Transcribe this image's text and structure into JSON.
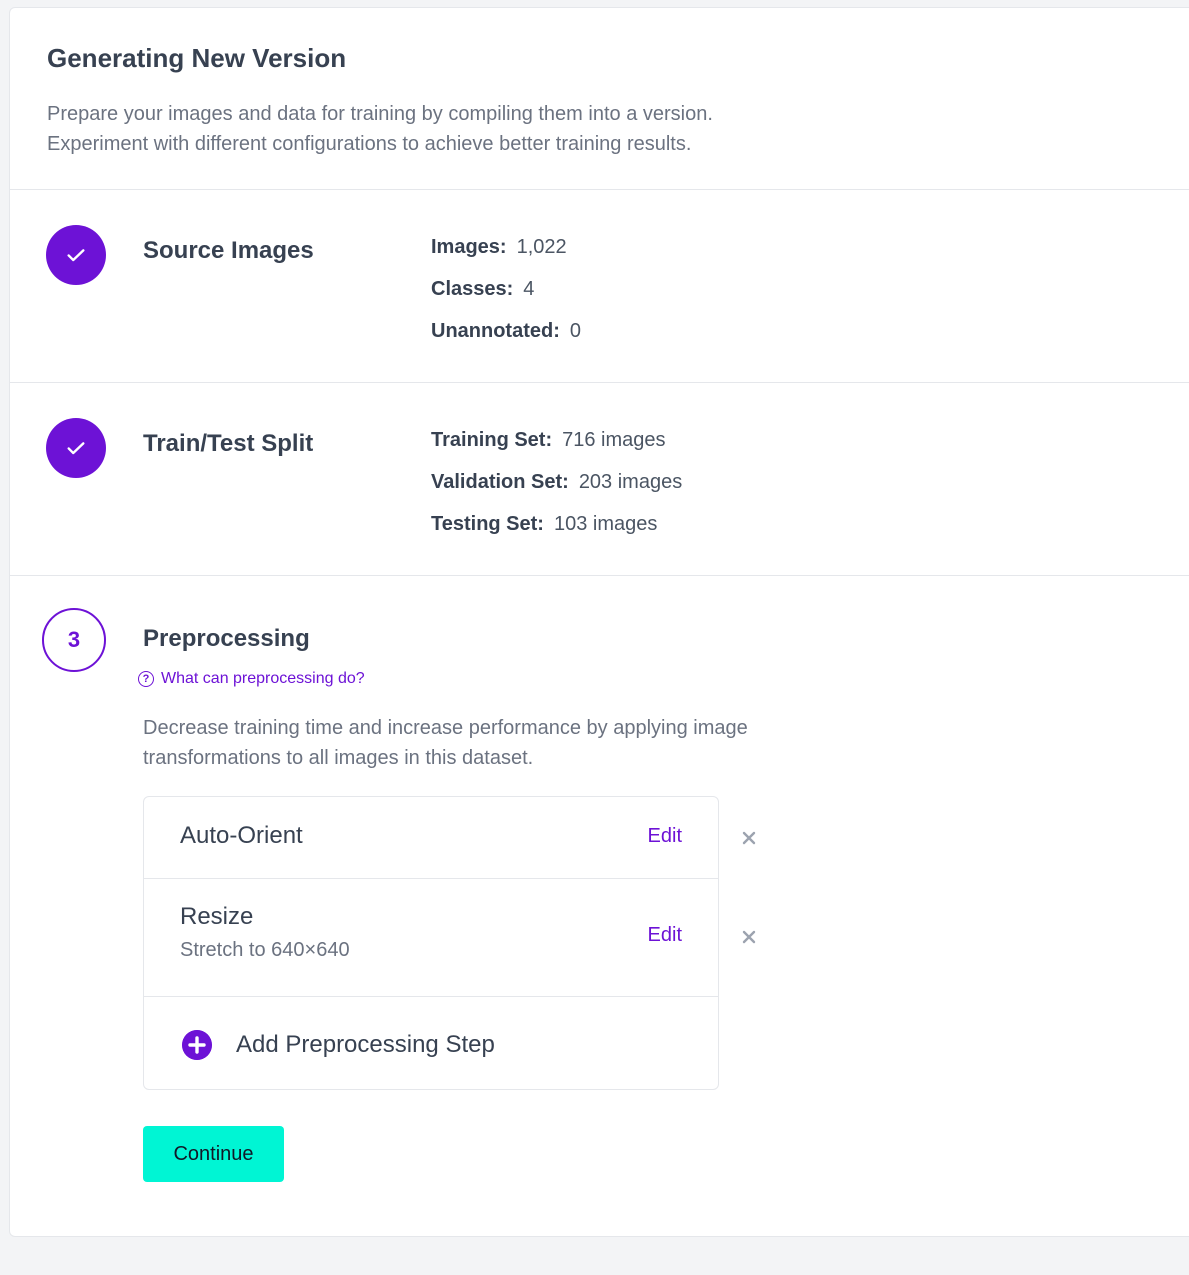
{
  "header": {
    "title": "Generating New Version",
    "description_line1": "Prepare your images and data for training by compiling them into a version.",
    "description_line2": "Experiment with different configurations to achieve better training results."
  },
  "source_images": {
    "title": "Source Images",
    "stats": [
      {
        "label": "Images:",
        "value": "1,022"
      },
      {
        "label": "Classes:",
        "value": "4"
      },
      {
        "label": "Unannotated:",
        "value": "0"
      }
    ]
  },
  "train_test_split": {
    "title": "Train/Test Split",
    "stats": [
      {
        "label": "Training Set:",
        "value": "716 images"
      },
      {
        "label": "Validation Set:",
        "value": "203 images"
      },
      {
        "label": "Testing Set:",
        "value": "103 images"
      }
    ]
  },
  "preprocessing": {
    "step_number": "3",
    "title": "Preprocessing",
    "help_link": "What can preprocessing do?",
    "description_line1": "Decrease training time and increase performance by applying image",
    "description_line2": "transformations to all images in this dataset.",
    "steps": [
      {
        "name": "Auto-Orient",
        "subtitle": "",
        "edit_label": "Edit"
      },
      {
        "name": "Resize",
        "subtitle": "Stretch to 640×640",
        "edit_label": "Edit"
      }
    ],
    "add_label": "Add Preprocessing Step",
    "continue_label": "Continue"
  },
  "colors": {
    "accent": "#6d12d6",
    "continue_bg": "#00f5d4"
  },
  "icons": [
    "check-icon",
    "question-circle-icon",
    "close-icon",
    "plus-circle-icon"
  ]
}
